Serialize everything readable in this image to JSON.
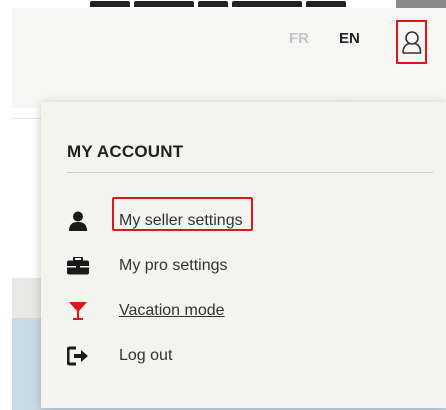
{
  "header": {
    "languages": [
      {
        "code": "FR",
        "active": false
      },
      {
        "code": "EN",
        "active": true
      }
    ],
    "user_icon": "user-icon"
  },
  "account_menu": {
    "title": "MY ACCOUNT",
    "items": [
      {
        "label": "My seller settings",
        "icon": "user-icon"
      },
      {
        "label": "My pro settings",
        "icon": "briefcase-icon"
      },
      {
        "label": "Vacation mode",
        "icon": "cocktail-icon",
        "highlighted": true
      },
      {
        "label": "Log out",
        "icon": "logout-icon"
      }
    ]
  },
  "colors": {
    "accent": "#e0151b",
    "text": "#333333",
    "inactive_lang": "#c4c4c4",
    "panel_bg": "#f3f3ef"
  }
}
